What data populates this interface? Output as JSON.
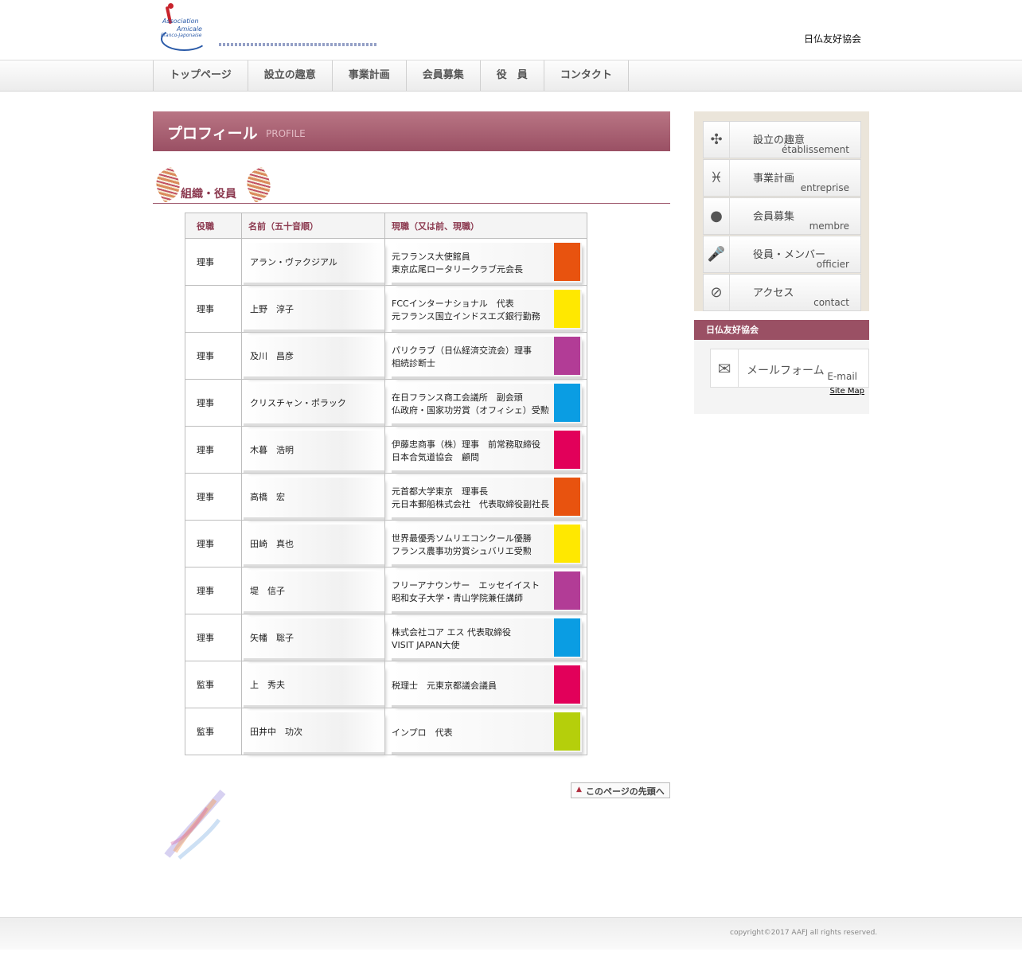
{
  "header": {
    "logo_lines": [
      "Association",
      "Amicale",
      "Franco-Japonaise"
    ],
    "site_name": "日仏友好協会"
  },
  "nav": [
    "トップページ",
    "設立の趣意",
    "事業計画",
    "会員募集",
    "役　員",
    "コンタクト"
  ],
  "page_heading": {
    "jp": "プロフィール",
    "en": "PROFILE"
  },
  "section_title": "組織・役員",
  "table": {
    "headers": [
      "役職",
      "名前（五十音順）",
      "現職（又は前、現職）"
    ],
    "rows": [
      {
        "role": "理事",
        "name": "アラン・ヴァクジアル",
        "job": [
          "元フランス大使館員",
          "東京広尾ロータリークラブ元会長"
        ],
        "color": "#e8530f"
      },
      {
        "role": "理事",
        "name": "上野　淳子",
        "job": [
          "FCCインターナショナル　代表",
          "元フランス国立インドスエズ銀行勤務"
        ],
        "color": "#ffe800"
      },
      {
        "role": "理事",
        "name": "及川　昌彦",
        "job": [
          "パリクラブ（日仏経済交流会）理事",
          "相続診断士"
        ],
        "color": "#b23c96"
      },
      {
        "role": "理事",
        "name": "クリスチャン・ポラック",
        "job": [
          "在日フランス商工会議所　副会頭",
          "仏政府・国家功労賞（オフィシェ）受勲"
        ],
        "color": "#0a9de3"
      },
      {
        "role": "理事",
        "name": "木暮　浩明",
        "job": [
          "伊藤忠商事（株）理事　前常務取締役",
          "日本合気道協会　顧問"
        ],
        "color": "#e2005a"
      },
      {
        "role": "理事",
        "name": "高橋　宏",
        "job": [
          "元首都大学東京　理事長",
          "元日本郵船株式会社　代表取締役副社長"
        ],
        "color": "#e8530f"
      },
      {
        "role": "理事",
        "name": "田崎　真也",
        "job": [
          "世界最優秀ソムリエコンクール優勝",
          "フランス農事功労賞シュバリエ受勲"
        ],
        "color": "#ffe800"
      },
      {
        "role": "理事",
        "name": "堤　信子",
        "job": [
          "フリーアナウンサー　エッセイイスト",
          "昭和女子大学・青山学院兼任講師"
        ],
        "color": "#b23c96"
      },
      {
        "role": "理事",
        "name": "矢幡　聡子",
        "job": [
          "株式会社コア エス 代表取締役",
          "VISIT JAPAN大使"
        ],
        "color": "#0a9de3"
      },
      {
        "role": "監事",
        "name": "上　秀夫",
        "job": [
          "税理士　元東京都議会議員"
        ],
        "color": "#e2005a"
      },
      {
        "role": "監事",
        "name": "田井中　功次",
        "job": [
          "インプロ　代表"
        ],
        "color": "#b5cf0b"
      }
    ]
  },
  "to_top_label": "このページの先頭へ",
  "sidebar": {
    "menu": [
      {
        "jp": "設立の趣意",
        "en": "établissement",
        "icon": "network-icon"
      },
      {
        "jp": "事業計画",
        "en": "entreprise",
        "icon": "pisces-icon"
      },
      {
        "jp": "会員募集",
        "en": "membre",
        "icon": "person-icon"
      },
      {
        "jp": "役員・メンバー",
        "en": "officier",
        "icon": "microphone-icon"
      },
      {
        "jp": "アクセス",
        "en": "contact",
        "icon": "compass-icon"
      }
    ],
    "box_title": "日仏友好協会",
    "mail_jp": "メールフォーム",
    "mail_en": "E-mail",
    "sitemap": "Site Map"
  },
  "footer": {
    "copyright": "copyright©2017 AAFJ  all rights reserved."
  }
}
